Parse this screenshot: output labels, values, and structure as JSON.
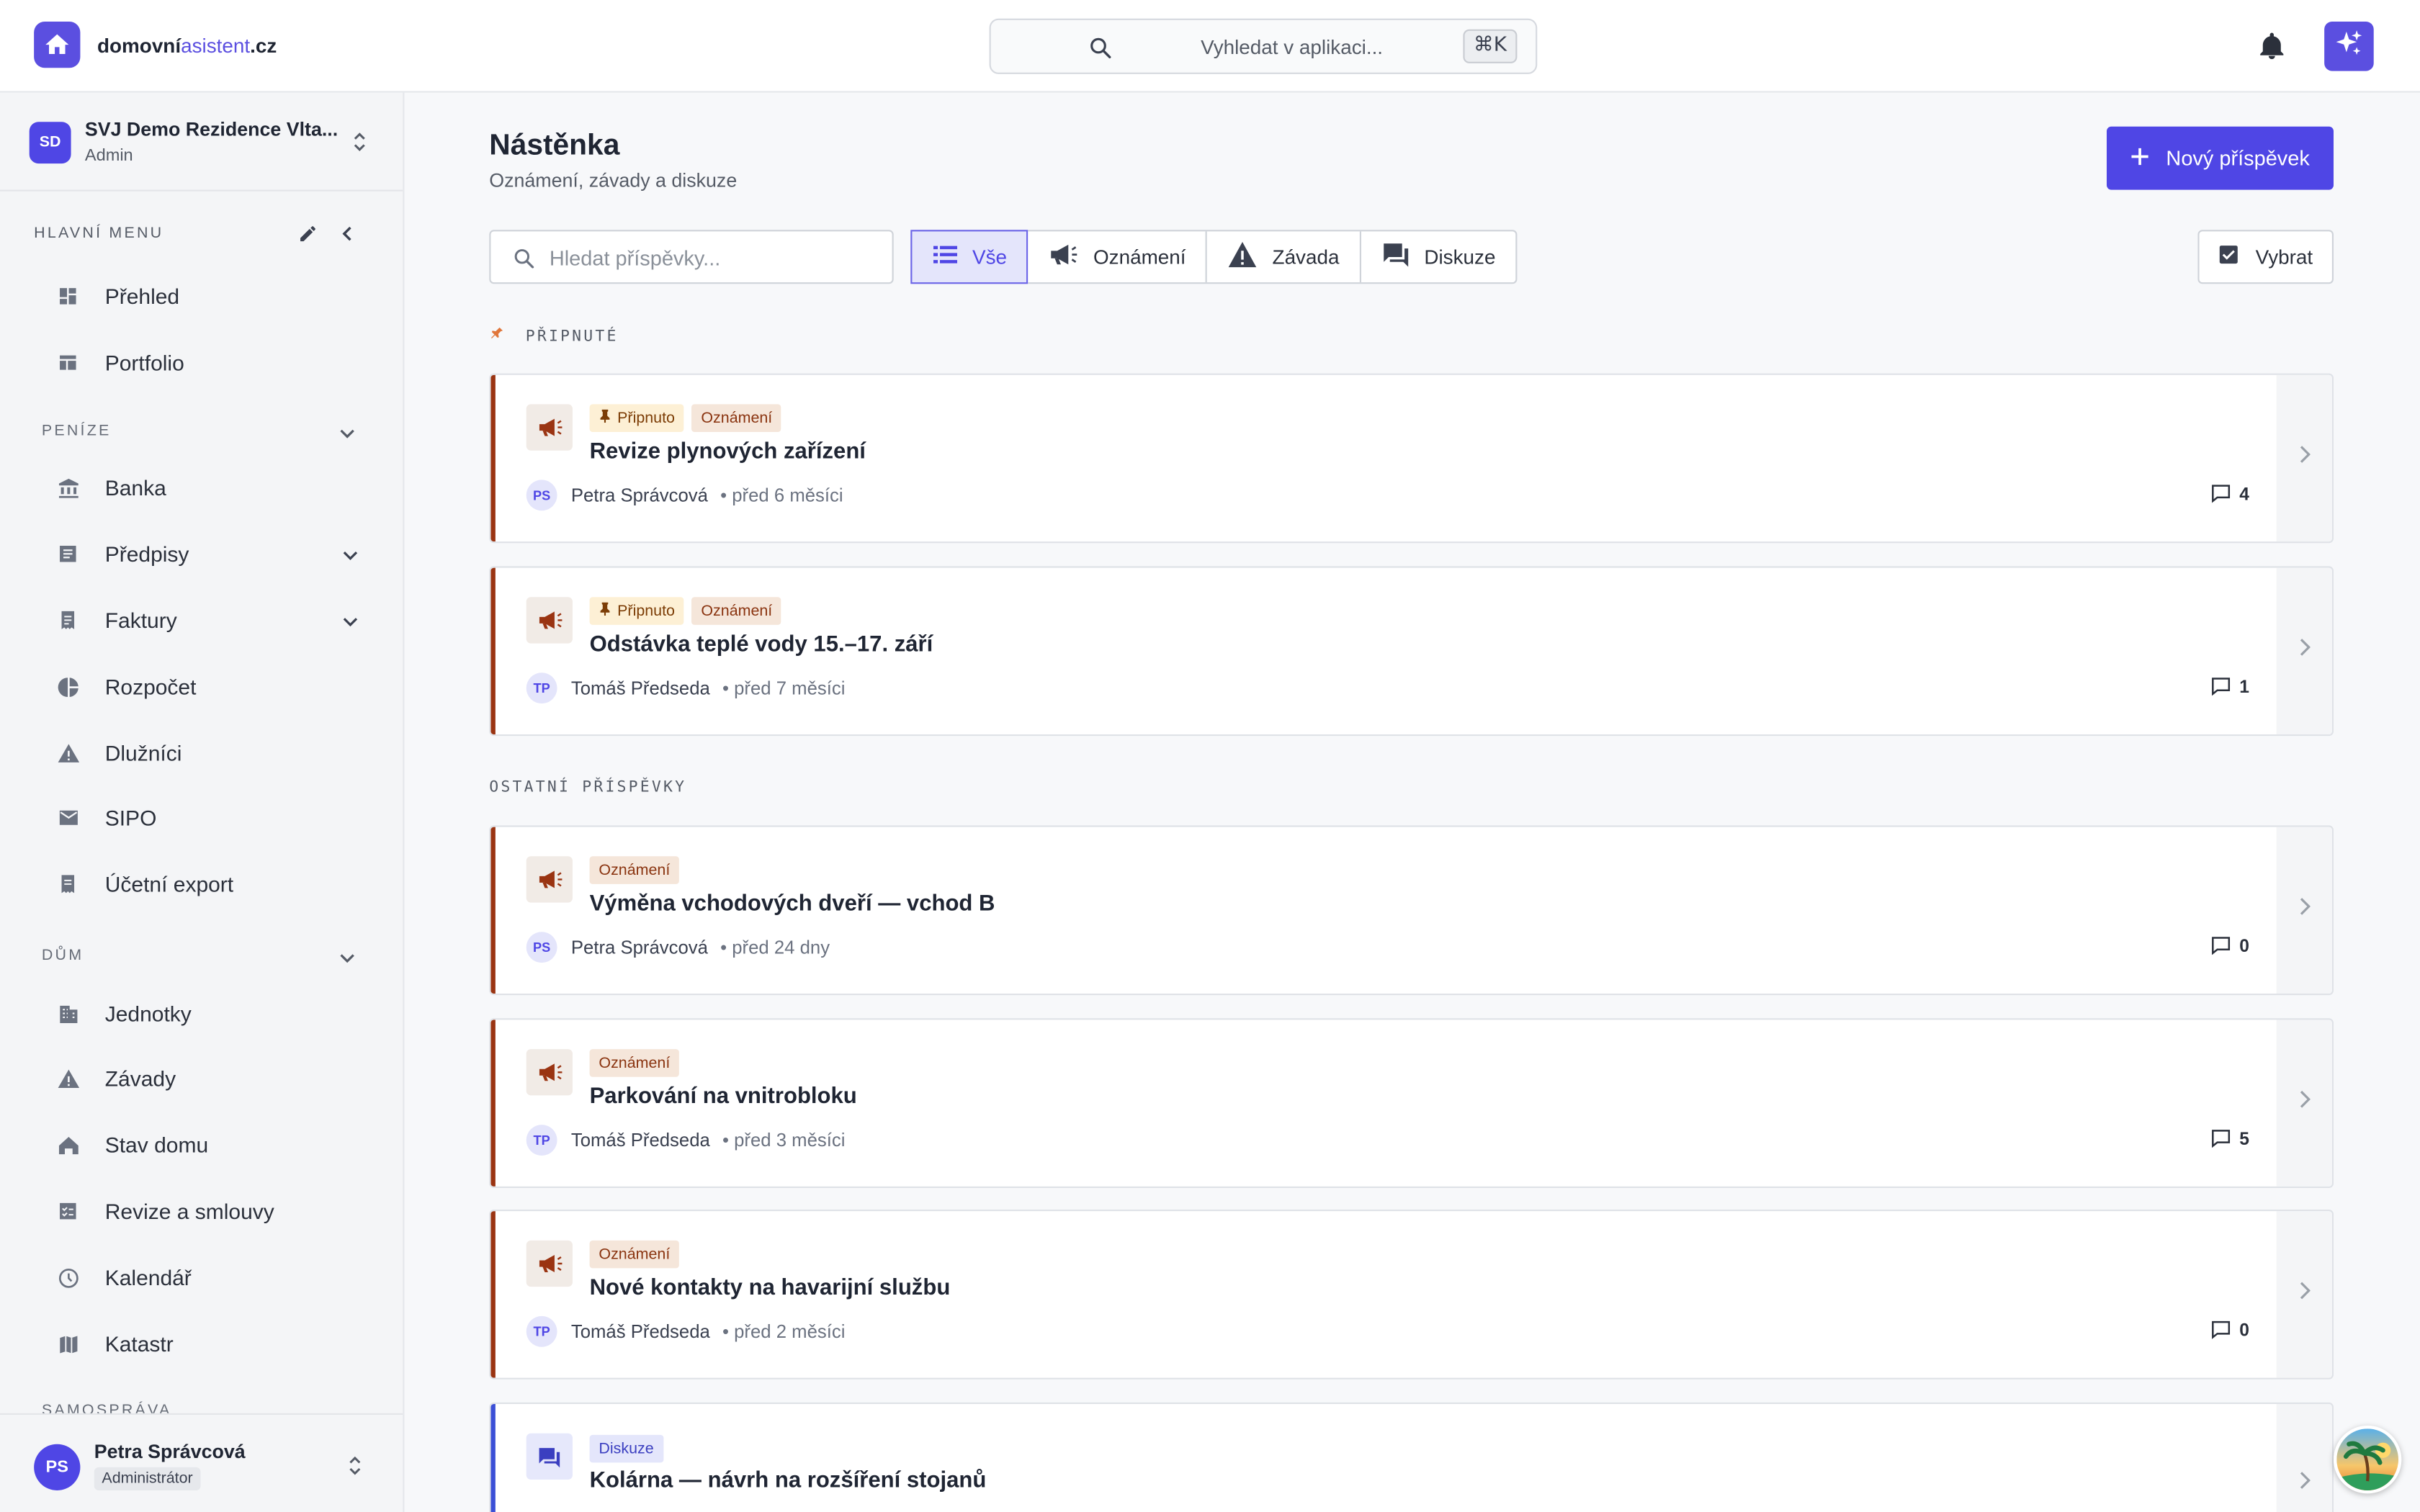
{
  "topbar": {
    "brand_main": "domovní",
    "brand_accent": "asistent",
    "brand_tld": ".cz",
    "search_placeholder": "Vyhledat v aplikaci...",
    "shortcut": "⌘K"
  },
  "org": {
    "initials": "SD",
    "name": "SVJ Demo Rezidence Vlta...",
    "role": "Admin"
  },
  "sidebar": {
    "menu_heading": "HLAVNÍ MENU",
    "top_items": [
      {
        "label": "Přehled",
        "icon": "dashboard-icon"
      },
      {
        "label": "Portfolio",
        "icon": "portfolio-icon"
      }
    ],
    "penize": {
      "label": "PENÍZE",
      "items": [
        {
          "label": "Banka",
          "icon": "bank-icon"
        },
        {
          "label": "Předpisy",
          "icon": "list-icon",
          "expandable": true
        },
        {
          "label": "Faktury",
          "icon": "receipt-icon",
          "expandable": true
        },
        {
          "label": "Rozpočet",
          "icon": "pie-chart-icon"
        },
        {
          "label": "Dlužníci",
          "icon": "warning-icon"
        },
        {
          "label": "SIPO",
          "icon": "mail-icon"
        },
        {
          "label": "Účetní export",
          "icon": "export-icon"
        }
      ]
    },
    "dum": {
      "label": "DŮM",
      "items": [
        {
          "label": "Jednotky",
          "icon": "building-icon"
        },
        {
          "label": "Závady",
          "icon": "warning-icon"
        },
        {
          "label": "Stav domu",
          "icon": "house-status-icon"
        },
        {
          "label": "Revize a smlouvy",
          "icon": "checklist-icon"
        },
        {
          "label": "Kalendář",
          "icon": "clock-icon"
        },
        {
          "label": "Katastr",
          "icon": "map-icon"
        }
      ]
    },
    "samosprava": {
      "label": "SAMOSPRÁVA"
    }
  },
  "user": {
    "initials": "PS",
    "name": "Petra Správcová",
    "role": "Administrátor"
  },
  "page": {
    "title": "Nástěnka",
    "subtitle": "Oznámení, závady a diskuze",
    "new_post": "Nový příspěvek",
    "search_placeholder": "Hledat příspěvky...",
    "filters": [
      {
        "label": "Vše",
        "icon": "list-icon",
        "active": true
      },
      {
        "label": "Oznámení",
        "icon": "megaphone-icon"
      },
      {
        "label": "Závada",
        "icon": "warning-icon"
      },
      {
        "label": "Diskuze",
        "icon": "forum-icon"
      }
    ],
    "select": "Vybrat",
    "pinned_label": "PŘIPNUTÉ",
    "other_label": "OSTATNÍ PŘÍSPĚVKY"
  },
  "pinned_posts": [
    {
      "title": "Revize plynových zařízení",
      "pin_tag": "Připnuto",
      "type_tag": "Oznámení",
      "author_initials": "PS",
      "author": "Petra Správcová",
      "time": "• před 6 měsíci",
      "comments": "4"
    },
    {
      "title": "Odstávka teplé vody 15.–17. září",
      "pin_tag": "Připnuto",
      "type_tag": "Oznámení",
      "author_initials": "TP",
      "author": "Tomáš Předseda",
      "time": "• před 7 měsíci",
      "comments": "1"
    }
  ],
  "other_posts": [
    {
      "title": "Výměna vchodových dveří — vchod B",
      "type_tag": "Oznámení",
      "author_initials": "PS",
      "author": "Petra Správcová",
      "time": "• před 24 dny",
      "comments": "0"
    },
    {
      "title": "Parkování na vnitrobloku",
      "type_tag": "Oznámení",
      "author_initials": "TP",
      "author": "Tomáš Předseda",
      "time": "• před 3 měsíci",
      "comments": "5"
    },
    {
      "title": "Nové kontakty na havarijní službu",
      "type_tag": "Oznámení",
      "author_initials": "TP",
      "author": "Tomáš Předseda",
      "time": "• před 2 měsíci",
      "comments": "0"
    },
    {
      "title": "Kolárna — návrh na rozšíření stojanů",
      "type_tag": "Diskuze"
    }
  ],
  "colors": {
    "accent": "#4f46e5",
    "announcement": "#9a3412",
    "discussion": "#3b4fd6"
  }
}
